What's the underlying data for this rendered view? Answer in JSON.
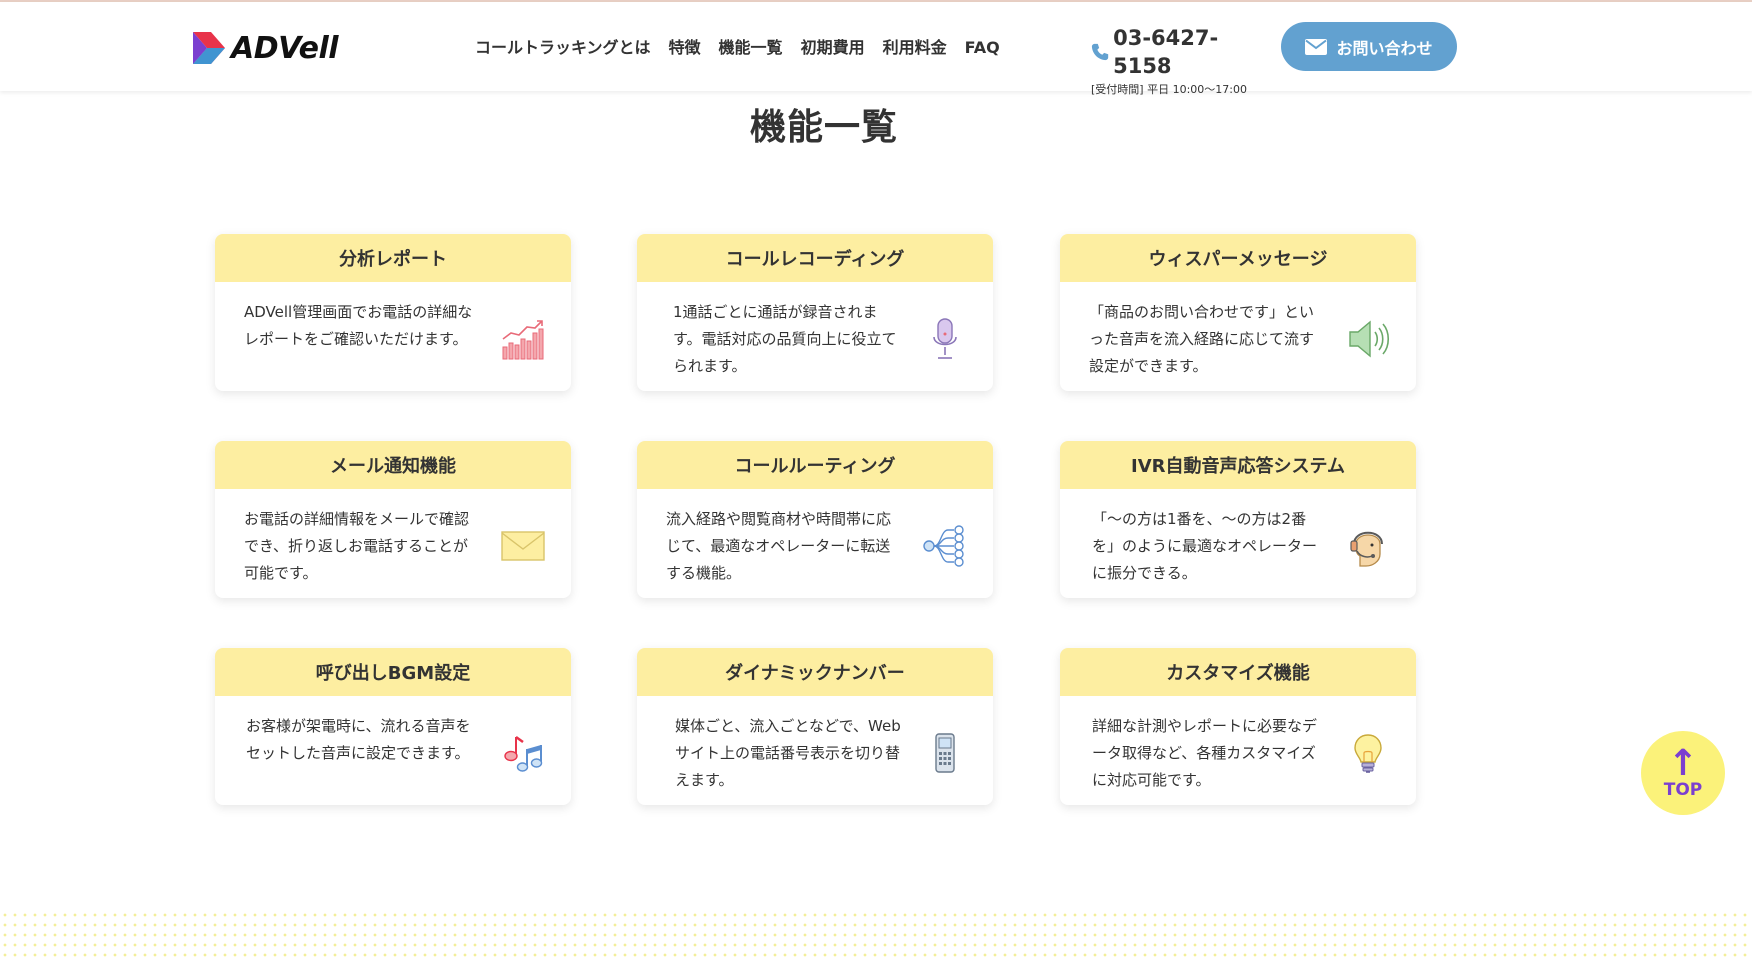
{
  "brand": {
    "name": "ADVell"
  },
  "nav": {
    "items": [
      {
        "label": "コールトラッキングとは"
      },
      {
        "label": "特徴"
      },
      {
        "label": "機能一覧"
      },
      {
        "label": "初期費用"
      },
      {
        "label": "利用料金"
      },
      {
        "label": "FAQ"
      }
    ]
  },
  "contact": {
    "phone": "03-6427-5158",
    "hours": "[受付時間] 平日 10:00〜17:00",
    "button_label": "お問い合わせ",
    "accent_color": "#62a1d0"
  },
  "section": {
    "title": "機能一覧",
    "cards": [
      {
        "title": "分析レポート",
        "text": "ADVell管理画面でお電話の詳細なレポートをご確認いただけます。",
        "icon": "chart-icon"
      },
      {
        "title": "コールレコーディング",
        "text": "1通話ごとに通話が録音されます。電話対応の品質向上に役立てられます。",
        "icon": "microphone-icon"
      },
      {
        "title": "ウィスパーメッセージ",
        "text": "「商品のお問い合わせです」といった音声を流入経路に応じて流す設定ができます。",
        "icon": "speaker-icon"
      },
      {
        "title": "メール通知機能",
        "text": "お電話の詳細情報をメールで確認でき、折り返しお電話することが可能です。",
        "icon": "envelope-icon"
      },
      {
        "title": "コールルーティング",
        "text": "流入経路や閲覧商材や時間帯に応じて、最適なオペレーターに転送する機能。",
        "icon": "routing-icon"
      },
      {
        "title": "IVR自動音声応答システム",
        "text": "「〜の方は1番を、〜の方は2番を」のように最適なオペレーターに振分できる。",
        "icon": "operator-headset-icon"
      },
      {
        "title": "呼び出しBGM設定",
        "text": "お客様が架電時に、流れる音声をセットした音声に設定できます。",
        "icon": "music-note-icon"
      },
      {
        "title": "ダイナミックナンバー",
        "text": "媒体ごと、流入ごとなどで、Webサイト上の電話番号表示を切り替えます。",
        "icon": "mobile-phone-icon"
      },
      {
        "title": "カスタマイズ機能",
        "text": "詳細な計測やレポートに必要なデータ取得など、各種カスタマイズに対応可能です。",
        "icon": "lightbulb-icon"
      }
    ],
    "header_color": "#fdeea1"
  },
  "top_button": {
    "arrow": "↑",
    "label": "TOP",
    "color": "#fbf27a"
  }
}
